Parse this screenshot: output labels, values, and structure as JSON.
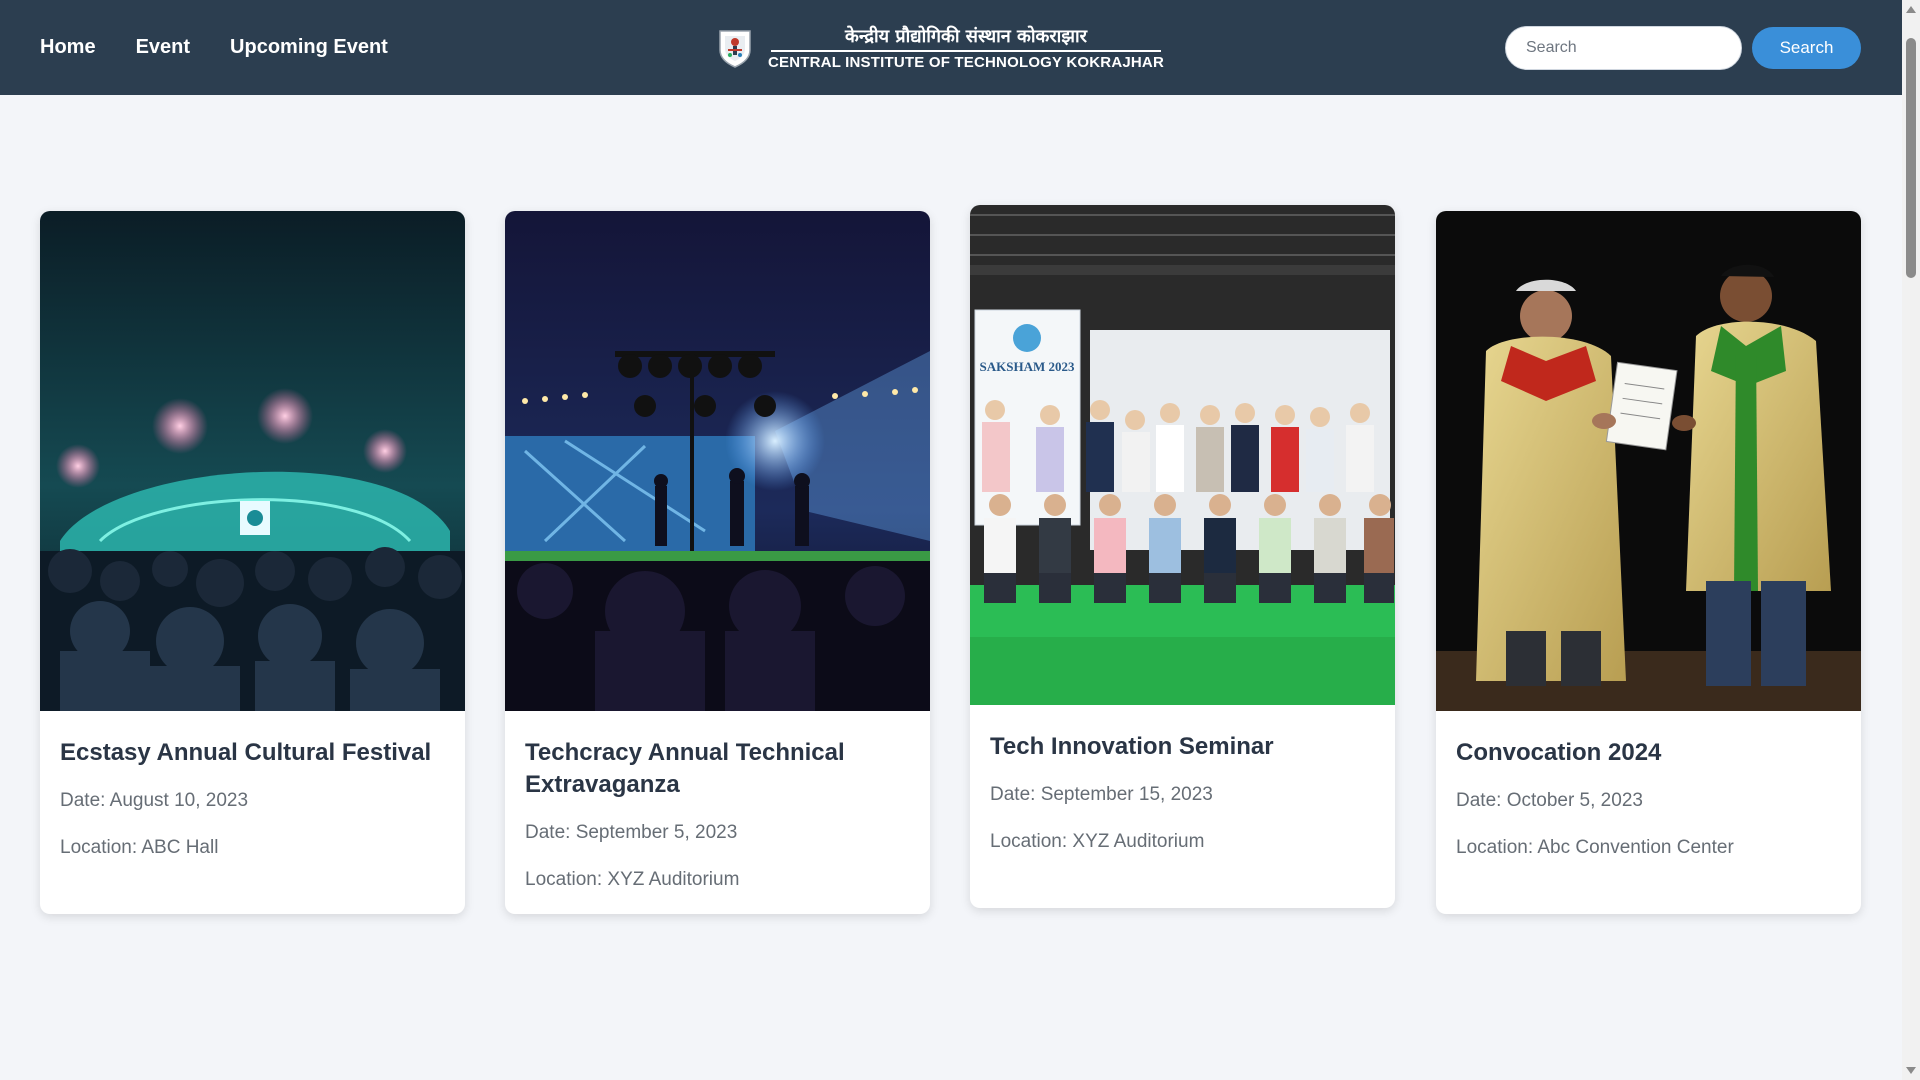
{
  "nav": {
    "links": [
      "Home",
      "Event",
      "Upcoming Event"
    ]
  },
  "brand": {
    "hindi": "केन्द्रीय प्रौद्योगिकी संस्थान कोकराझार",
    "english": "CENTRAL INSTITUTE OF TECHNOLOGY KOKRAJHAR",
    "logo_icon": "institute-crest-icon"
  },
  "search": {
    "placeholder": "Search",
    "button_label": "Search"
  },
  "events": [
    {
      "title": "Ecstasy Annual Cultural Festival",
      "date": "Date: August 10, 2023",
      "location": "Location: ABC Hall",
      "image": "concert-crowd-teal-stage"
    },
    {
      "title": "Techcracy Annual Technical Extravaganza",
      "date": "Date: September 5, 2023",
      "location": "Location: XYZ Auditorium",
      "image": "stage-lights-performers"
    },
    {
      "title": "Tech Innovation Seminar",
      "date": "Date: September 15, 2023",
      "location": "Location: XYZ Auditorium",
      "image": "group-photo-saksham-2023",
      "banner_text": "SAKSHAM 2023"
    },
    {
      "title": "Convocation 2024",
      "date": "Date: October 5, 2023",
      "location": "Location: Abc Convention Center",
      "image": "convocation-certificate-handover"
    }
  ],
  "colors": {
    "header_bg": "#2c3e50",
    "page_bg": "#f3f5f9",
    "search_button": "#3a8fd9"
  }
}
